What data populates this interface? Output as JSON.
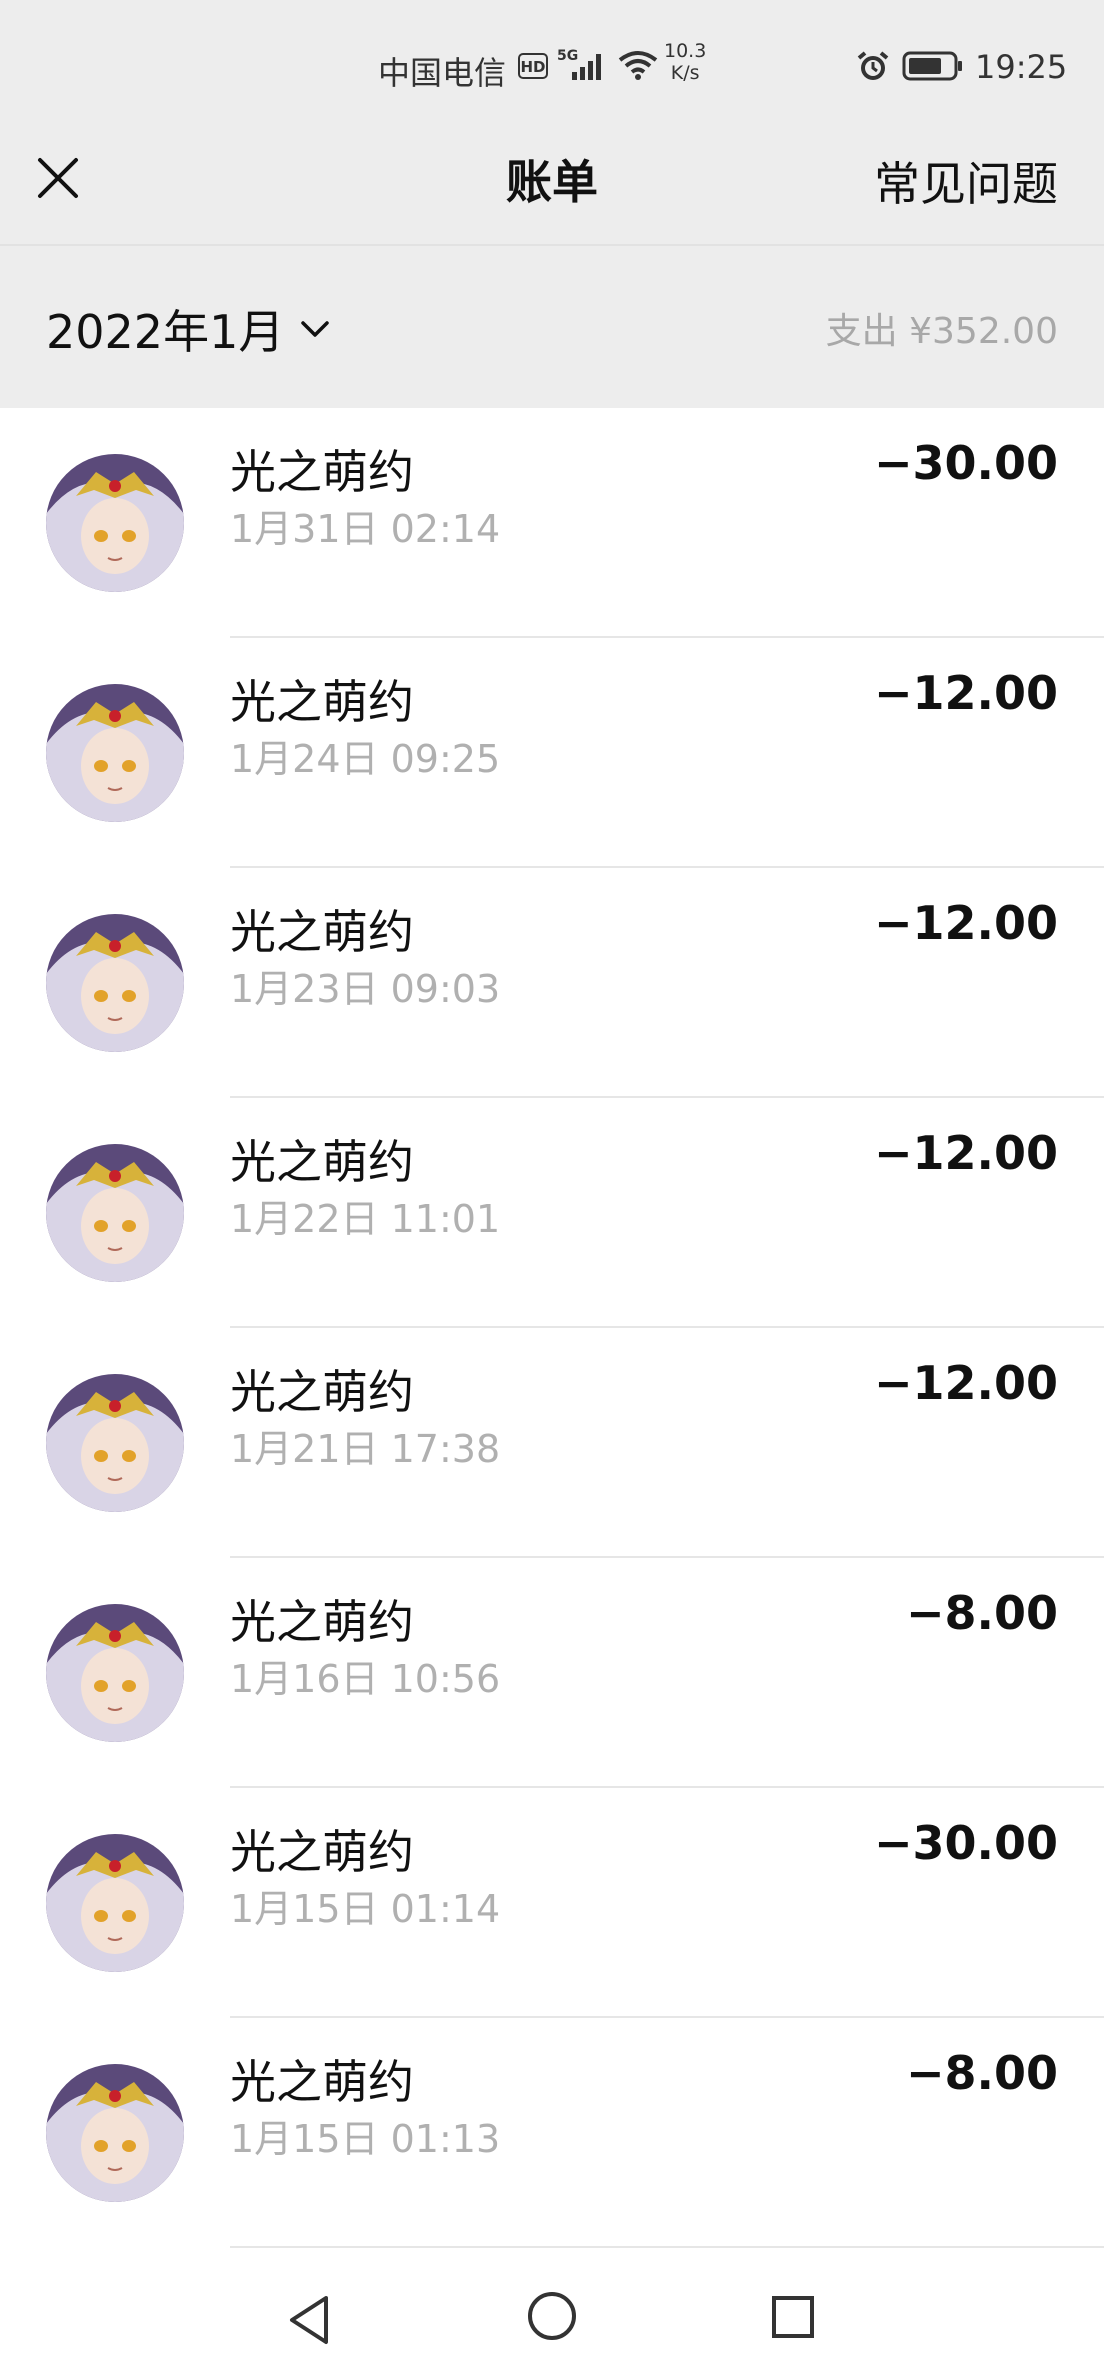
{
  "status_bar": {
    "carrier": "中国电信",
    "hd": "HD",
    "network": "5G",
    "speed_value": "10.3",
    "speed_unit": "K/s",
    "time": "19:25"
  },
  "header": {
    "title": "账单",
    "faq_label": "常见问题"
  },
  "filter": {
    "month": "2022年1月",
    "summary": "支出 ¥352.00"
  },
  "transactions": [
    {
      "title": "光之萌约",
      "time": "1月31日 02:14",
      "amount": "−30.00"
    },
    {
      "title": "光之萌约",
      "time": "1月24日 09:25",
      "amount": "−12.00"
    },
    {
      "title": "光之萌约",
      "time": "1月23日 09:03",
      "amount": "−12.00"
    },
    {
      "title": "光之萌约",
      "time": "1月22日 11:01",
      "amount": "−12.00"
    },
    {
      "title": "光之萌约",
      "time": "1月21日 17:38",
      "amount": "−12.00"
    },
    {
      "title": "光之萌约",
      "time": "1月16日 10:56",
      "amount": "−8.00"
    },
    {
      "title": "光之萌约",
      "time": "1月15日 01:14",
      "amount": "−30.00"
    },
    {
      "title": "光之萌约",
      "time": "1月15日 01:13",
      "amount": "−8.00"
    }
  ],
  "icons": {
    "close": "close-icon",
    "chevron": "chevron-down-icon",
    "back": "back-icon",
    "home": "home-icon",
    "recent": "recent-apps-icon"
  }
}
